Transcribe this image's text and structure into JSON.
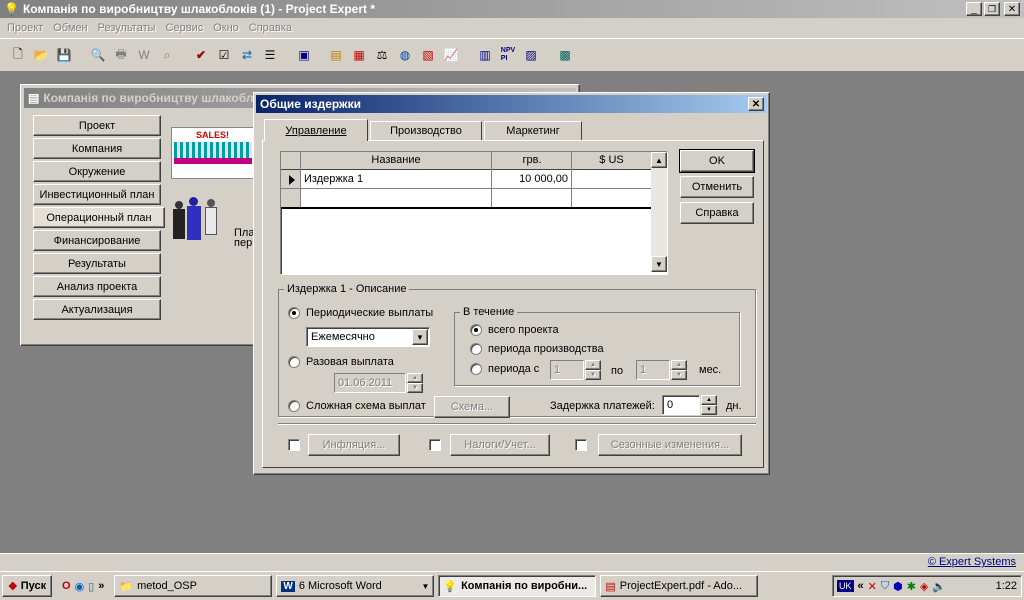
{
  "app": {
    "title": "Компанія по виробництву шлакоблоків (1) - Project Expert *",
    "menu": [
      "Проект",
      "Обмен",
      "Результаты",
      "Сервис",
      "Окно",
      "Справка"
    ]
  },
  "child_window": {
    "title": "Компанія по виробництву шлакоблоків (1)",
    "nav": [
      "Проект",
      "Компания",
      "Окружение",
      "Инвестиционный план",
      "Операционный план",
      "Финансирование",
      "Результаты",
      "Анализ проекта",
      "Актуализация"
    ],
    "sales_label": "SALES!",
    "partial_text_1": "Пла",
    "partial_text_2": "пер"
  },
  "dialog": {
    "title": "Общие издержки",
    "tabs": [
      "Управление",
      "Производство",
      "Маркетинг"
    ],
    "grid": {
      "headers": [
        "Название",
        "грв.",
        "$ US"
      ],
      "rows": [
        {
          "name": "Издержка 1",
          "uah": "10 000,00",
          "usd": ""
        }
      ]
    },
    "buttons": {
      "ok": "OK",
      "cancel": "Отменить",
      "help": "Справка"
    },
    "desc_group": "Издержка 1 - Описание",
    "periodic_label": "Периодические выплаты",
    "frequency_value": "Ежемесячно",
    "one_time_label": "Разовая выплата",
    "one_time_date": "01.06.2011",
    "complex_label": "Сложная схема выплат",
    "scheme_button": "Схема...",
    "during_group": "В течение",
    "whole_project": "всего проекта",
    "production_period": "периода производства",
    "period_from": "периода с",
    "from_value": "1",
    "to_label": "по",
    "to_value": "1",
    "months": "мес.",
    "delay_label": "Задержка платежей:",
    "delay_value": "0",
    "days": "дн.",
    "inflation": "Инфляция...",
    "taxes": "Налоги/Учет...",
    "seasonal": "Сезонные изменения..."
  },
  "statusbar": {
    "link": "© Expert Systems"
  },
  "taskbar": {
    "start": "Пуск",
    "items": [
      "metod_OSP",
      "6 Microsoft Word",
      "Компанія по виробни...",
      "ProjectExpert.pdf - Ado..."
    ],
    "lang": "UK",
    "clock": "1:22"
  }
}
